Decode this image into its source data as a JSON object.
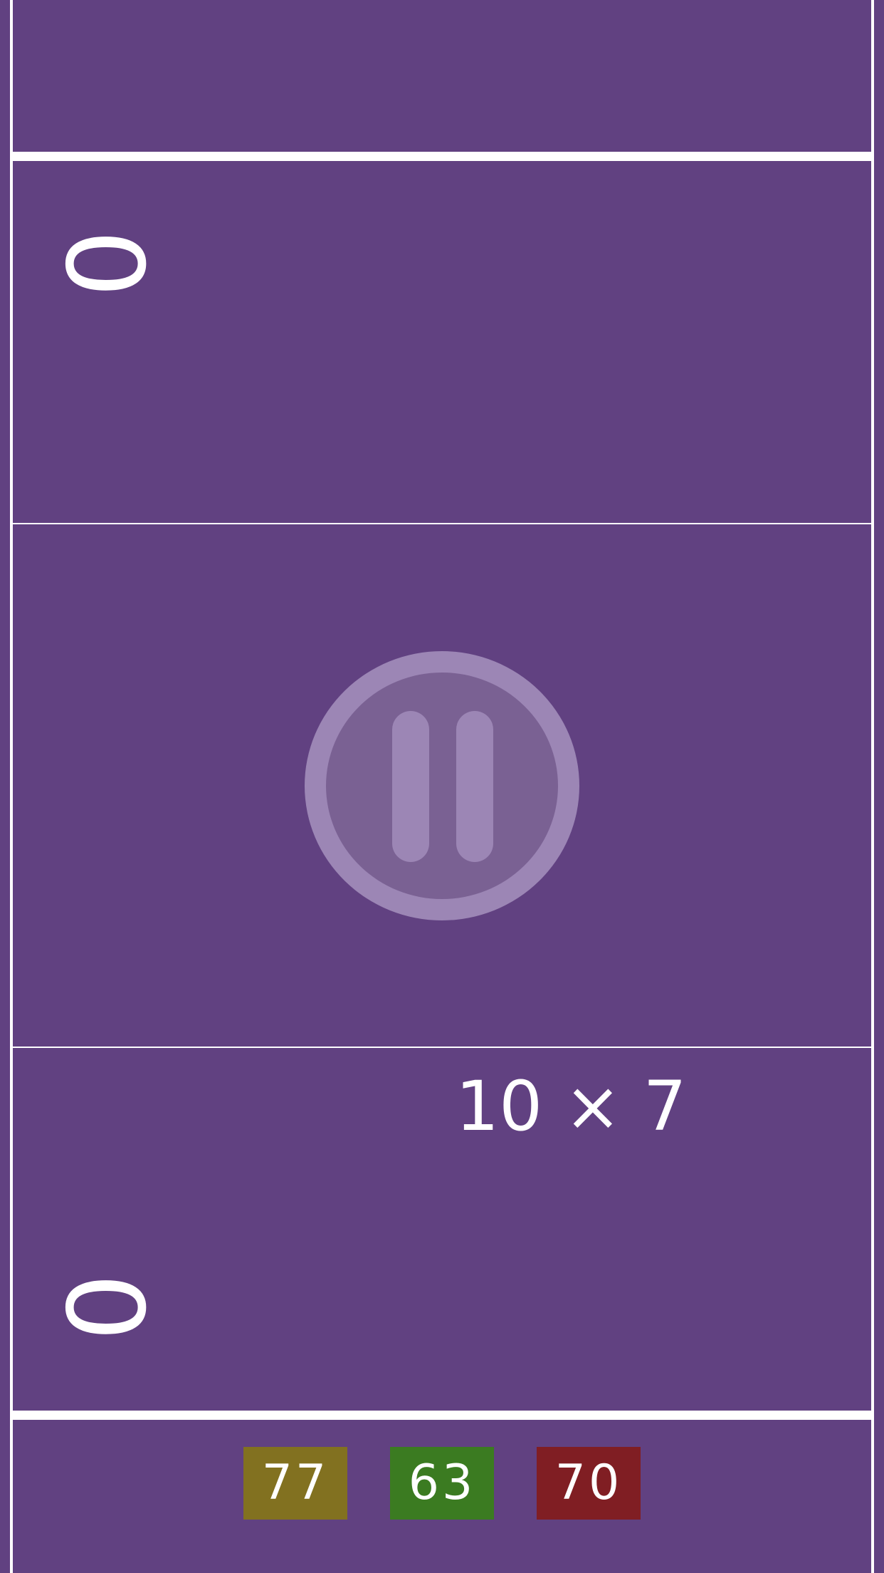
{
  "colors": {
    "background": "#614181",
    "lines": "#ffffff",
    "pause_outer": "#9c86b5",
    "pause_inner": "#7a6193"
  },
  "scores": {
    "top_player": "0",
    "bottom_player": "0"
  },
  "problem": {
    "text": "10 × 7"
  },
  "pause": {
    "icon": "pause-icon"
  },
  "answers": [
    {
      "label": "77",
      "color": "#827120"
    },
    {
      "label": "63",
      "color": "#3b7b21"
    },
    {
      "label": "70",
      "color": "#801e23"
    }
  ]
}
